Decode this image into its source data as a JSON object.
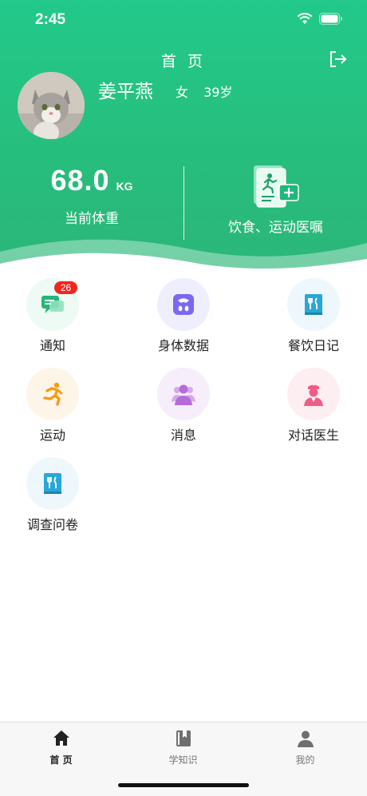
{
  "status_bar": {
    "time": "2:45"
  },
  "header": {
    "title": "首 页"
  },
  "user": {
    "name": "姜平燕",
    "gender": "女",
    "age": "39岁"
  },
  "weight": {
    "value": "68.0",
    "unit": "KG",
    "label": "当前体重"
  },
  "advice": {
    "label": "饮食、运动医嘱"
  },
  "menu": [
    {
      "label": "通知",
      "badge": "26",
      "icon": "chat-icon",
      "color": "#22b77a"
    },
    {
      "label": "身体数据",
      "icon": "scale-icon",
      "color": "#7b68ee"
    },
    {
      "label": "餐饮日记",
      "icon": "cutlery-book-icon",
      "color": "#2aa7d6"
    },
    {
      "label": "运动",
      "icon": "running-icon",
      "color": "#f39c12"
    },
    {
      "label": "消息",
      "icon": "group-icon",
      "color": "#b56bd8"
    },
    {
      "label": "对话医生",
      "icon": "doctor-icon",
      "color": "#ef5d86"
    },
    {
      "label": "调查问卷",
      "icon": "questionnaire-icon",
      "color": "#2aa7d6"
    }
  ],
  "tabs": [
    {
      "label": "首 页",
      "icon": "home-icon",
      "active": true
    },
    {
      "label": "学知识",
      "icon": "book-icon",
      "active": false
    },
    {
      "label": "我的",
      "icon": "user-icon",
      "active": false
    }
  ],
  "colors": {
    "brand_green": "#27bd7c",
    "badge_red": "#f0271f"
  }
}
